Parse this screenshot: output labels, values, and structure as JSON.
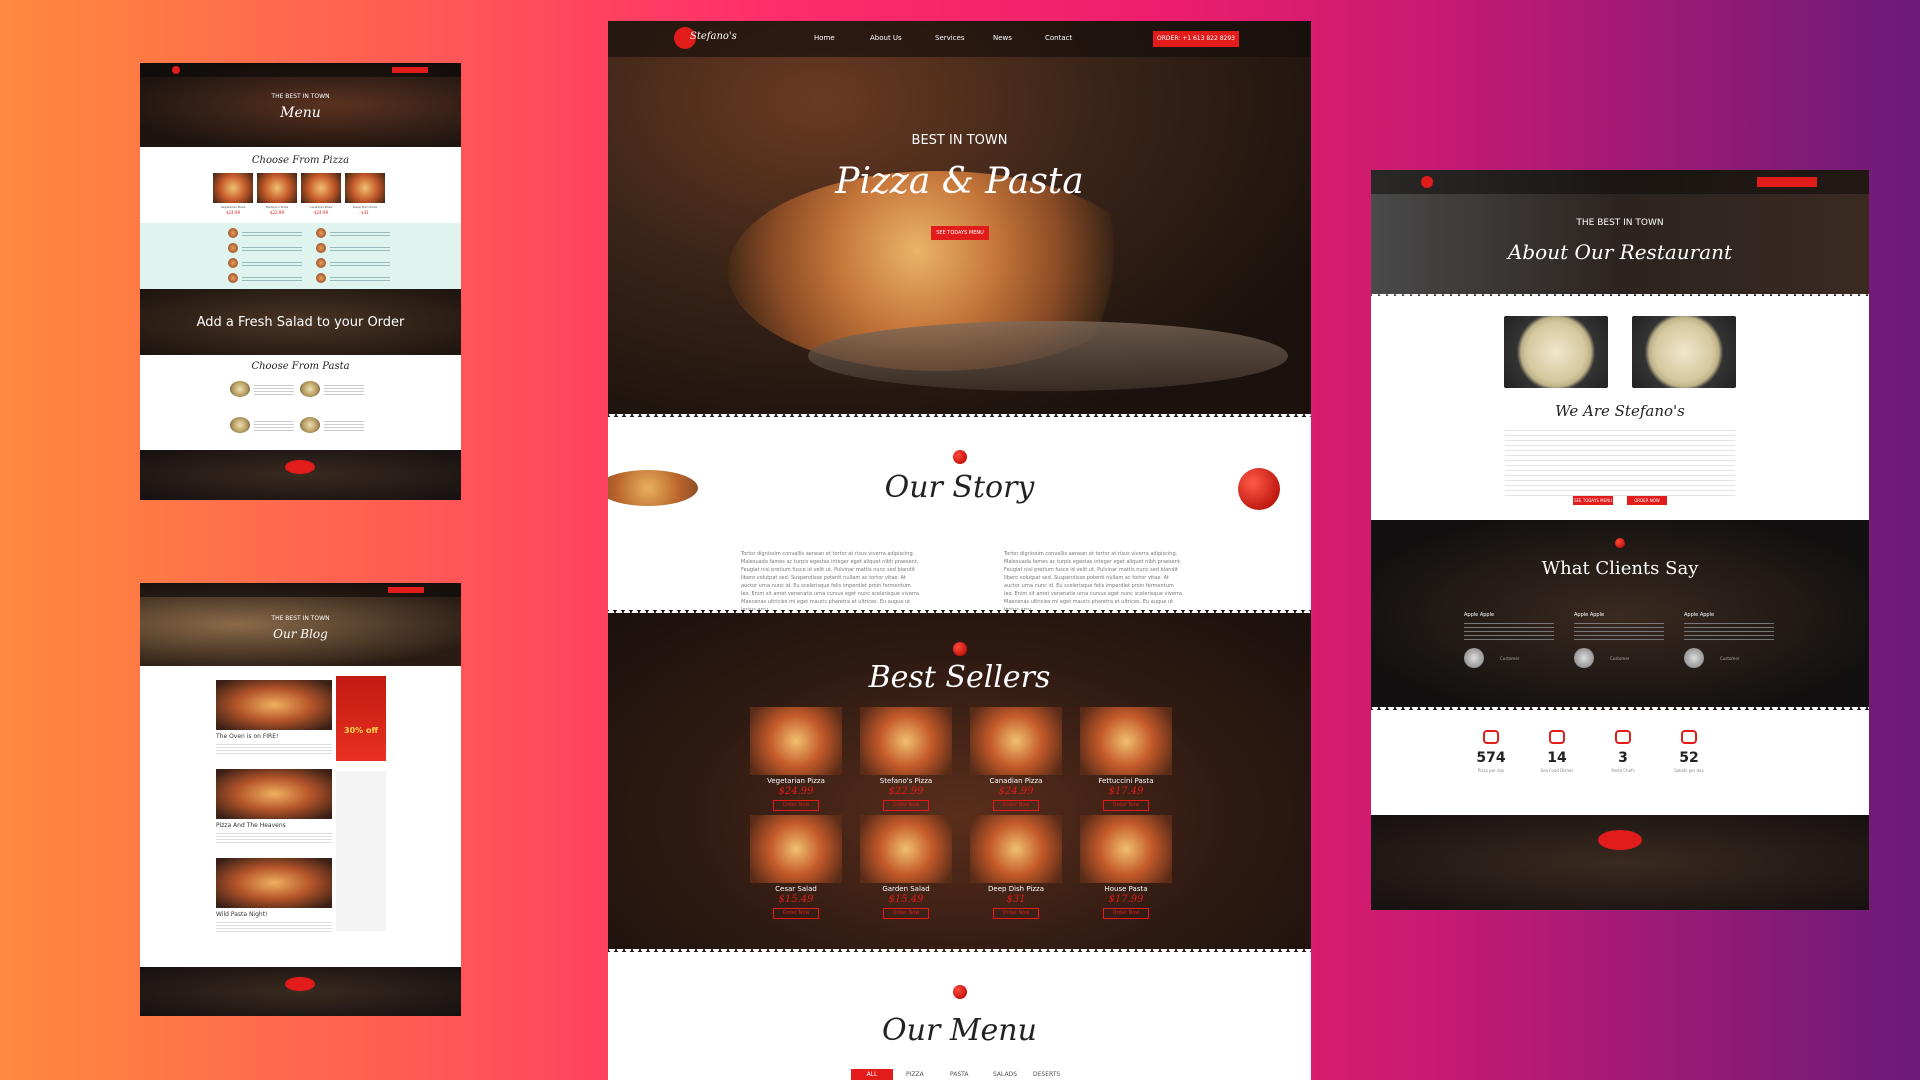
{
  "brand": {
    "logo": "Stefano's"
  },
  "nav": {
    "items": [
      "Home",
      "About Us",
      "Services",
      "News",
      "Contact"
    ],
    "order_cta": "ORDER: +1 613 822 8293"
  },
  "hero": {
    "kicker": "BEST IN TOWN",
    "title": "Pizza & Pasta",
    "button": "SEE TODAYS MENU"
  },
  "story": {
    "title": "Our Story",
    "col1": "Tortor dignissim convallis aenean et tortor at risus viverra adipiscing. Malesuada fames ac turpis egestas integer eget aliquet nibh praesent. Feugiat nisl pretium fusce id velit ut. Pulvinar mattis nunc sed blandit libero volutpat sed. Suspendisse potenti nullam ac tortor vitae. At auctor urna nunc id. Eu scelerisque felis imperdiet proin fermentum leo. Enim sit amet venenatis urna cursus eget nunc scelerisque viverra. Maecenas ultricies mi eget mauris pharetra et ultrices. Eu augue ut lectus arcu.",
    "col2": "Tortor dignissim convallis aenean et tortor at risus viverra adipiscing. Malesuada fames ac turpis egestas integer eget aliquet nibh praesent. Feugiat nisl pretium fusce id velit ut. Pulvinar mattis nunc sed blandit libero volutpat sed. Suspendisse potenti nullam ac tortor vitae. At auctor urna nunc id. Eu scelerisque felis imperdiet proin fermentum leo. Enim sit amet venenatis urna cursus eget nunc scelerisque viverra. Maecenas ultricies mi eget mauris pharetra et ultrices. Eu augue ut lectus arcu."
  },
  "bestsellers": {
    "title": "Best Sellers",
    "order_label": "Order Now",
    "items": [
      {
        "name": "Vegetarian Pizza",
        "price": "$24.99"
      },
      {
        "name": "Stefano's Pizza",
        "price": "$22.99"
      },
      {
        "name": "Canadian Pizza",
        "price": "$24.99"
      },
      {
        "name": "Fettuccini Pasta",
        "price": "$17.49"
      },
      {
        "name": "Cesar Salad",
        "price": "$15.49"
      },
      {
        "name": "Garden Salad",
        "price": "$15.49"
      },
      {
        "name": "Deep Dish Pizza",
        "price": "$31"
      },
      {
        "name": "House Pasta",
        "price": "$17.99"
      }
    ]
  },
  "menu": {
    "title": "Our Menu",
    "tabs": [
      "ALL",
      "PIZZA",
      "PASTA",
      "SALADS",
      "DESERTS"
    ]
  },
  "left_top": {
    "kicker": "THE BEST IN TOWN",
    "title": "Menu",
    "choose_pizza": "Choose From Pizza",
    "salad_banner": "Add a Fresh Salad to your Order",
    "choose_pasta": "Choose From Pasta",
    "pizzas": [
      {
        "name": "Vegetarian Pizza",
        "price": "$24.99"
      },
      {
        "name": "Stefano's Pizza",
        "price": "$22.99"
      },
      {
        "name": "Canadian Pizza",
        "price": "$24.99"
      },
      {
        "name": "Deep Dish Pizza",
        "price": "$31"
      }
    ]
  },
  "left_bottom": {
    "kicker": "THE BEST IN TOWN",
    "title": "Our Blog",
    "posts": [
      "The Oven is on FIRE!",
      "Pizza And The Heavens",
      "Wild Pasta Night!"
    ],
    "promo": "30% off"
  },
  "right": {
    "kicker": "THE BEST IN TOWN",
    "title": "About Our Restaurant",
    "heading": "We Are Stefano's",
    "btn1": "SEE TODAYS MENU",
    "btn2": "ORDER NOW",
    "clients_title": "What Clients Say",
    "clients": [
      {
        "name": "Apple Apple",
        "role": "Customer"
      },
      {
        "name": "Apple Apple",
        "role": "Customer"
      },
      {
        "name": "Apple Apple",
        "role": "Customer"
      }
    ],
    "stats": [
      {
        "value": "574",
        "label": "Pizza per day"
      },
      {
        "value": "14",
        "label": "Sea Food Dishes"
      },
      {
        "value": "3",
        "label": "Pasta Chefs"
      },
      {
        "value": "52",
        "label": "Salads per day"
      }
    ]
  }
}
